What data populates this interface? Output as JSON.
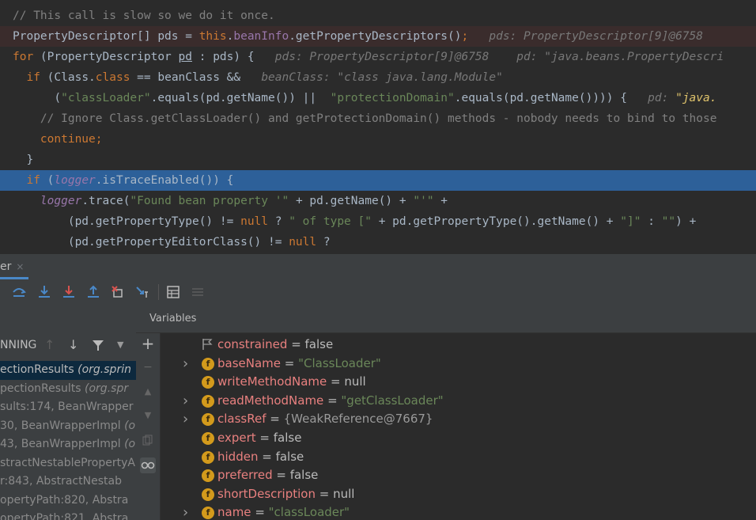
{
  "editor": {
    "lines": [
      [
        [
          "tok-comment",
          "// This call is slow so we do it once."
        ]
      ],
      [
        [
          "tok-plain",
          "PropertyDescriptor[] pds = "
        ],
        [
          "tok-kw",
          "this"
        ],
        [
          "tok-plain",
          "."
        ],
        [
          "tok-field",
          "beanInfo"
        ],
        [
          "tok-plain",
          ".getPropertyDescriptors()"
        ],
        [
          "tok-kw",
          ";"
        ],
        [
          "tok-hint",
          "   pds: PropertyDescriptor[9]@6758"
        ]
      ],
      [
        [
          "tok-kw",
          "for "
        ],
        [
          "tok-plain",
          "(PropertyDescriptor "
        ],
        [
          "tok-ul",
          "pd"
        ],
        [
          "tok-plain",
          " : pds) {"
        ],
        [
          "tok-hint",
          "   pds: PropertyDescriptor[9]@6758    pd: \"java.beans.PropertyDescri"
        ]
      ],
      [
        [
          "tok-plain",
          "  "
        ],
        [
          "tok-kw",
          "if "
        ],
        [
          "tok-plain",
          "(Class."
        ],
        [
          "tok-kw",
          "class"
        ],
        [
          "tok-plain",
          " == beanClass &&"
        ],
        [
          "tok-hint",
          "   beanClass: \"class java.lang.Module\""
        ]
      ],
      [
        [
          "tok-plain",
          "      ("
        ],
        [
          "tok-str",
          "\"classLoader\""
        ],
        [
          "tok-plain",
          ".equals(pd.getName()) ||  "
        ],
        [
          "tok-str",
          "\"protectionDomain\""
        ],
        [
          "tok-plain",
          ".equals(pd.getName()))) {"
        ],
        [
          "tok-hint",
          "   pd: "
        ],
        [
          "tok-hintv",
          "\"java."
        ]
      ],
      [
        [
          "tok-comment",
          "    // Ignore Class.getClassLoader() and getProtectionDomain() methods - nobody needs to bind to those"
        ]
      ],
      [
        [
          "tok-plain",
          "    "
        ],
        [
          "tok-kw",
          "continue;"
        ]
      ],
      [
        [
          "tok-plain",
          "  }"
        ]
      ],
      [
        [
          "tok-plain",
          "  "
        ],
        [
          "tok-kw",
          "if "
        ],
        [
          "tok-plain",
          "("
        ],
        [
          "tok-italicf",
          "logger"
        ],
        [
          "tok-plain",
          ".isTraceEnabled()) {"
        ]
      ],
      [
        [
          "tok-plain",
          "    "
        ],
        [
          "tok-italicf",
          "logger"
        ],
        [
          "tok-plain",
          ".trace("
        ],
        [
          "tok-str",
          "\"Found bean property '\""
        ],
        [
          "tok-plain",
          " + pd.getName() + "
        ],
        [
          "tok-str",
          "\"'\""
        ],
        [
          "tok-plain",
          " +"
        ]
      ],
      [
        [
          "tok-plain",
          "        (pd.getPropertyType() != "
        ],
        [
          "tok-kw",
          "null"
        ],
        [
          "tok-plain",
          " ? "
        ],
        [
          "tok-str",
          "\" of type [\""
        ],
        [
          "tok-plain",
          " + pd.getPropertyType().getName() + "
        ],
        [
          "tok-str",
          "\"]\""
        ],
        [
          "tok-plain",
          " : "
        ],
        [
          "tok-str",
          "\"\""
        ],
        [
          "tok-plain",
          ") +"
        ]
      ],
      [
        [
          "tok-plain",
          "        (pd.getPropertyEditorClass() != "
        ],
        [
          "tok-kw",
          "null"
        ],
        [
          "tok-plain",
          " ?"
        ]
      ]
    ]
  },
  "tab": {
    "label": "er",
    "close": "×"
  },
  "frames_header": {
    "status": "NNING"
  },
  "frames": [
    {
      "name": "ectionResults",
      "loc": " (org.sprin"
    },
    {
      "name": "pectionResults",
      "loc": " (org.spr"
    },
    {
      "name": "sults:174, BeanWrapper",
      "loc": ""
    },
    {
      "name": "30, BeanWrapperImpl",
      "loc": " (o"
    },
    {
      "name": "43, BeanWrapperImpl",
      "loc": " (o"
    },
    {
      "name": "stractNestablePropertyA",
      "loc": ""
    },
    {
      "name": "r:843, AbstractNestab",
      "loc": ""
    },
    {
      "name": "opertyPath:820, Abstra",
      "loc": ""
    },
    {
      "name": "opertyPath:821, Abstra",
      "loc": ""
    }
  ],
  "variables": {
    "header": "Variables",
    "items": [
      {
        "name": "constrained",
        "value": "false",
        "kind": "plain",
        "expandable": false,
        "icon": "flag"
      },
      {
        "name": "baseName",
        "value": "\"ClassLoader\"",
        "kind": "str",
        "expandable": true,
        "icon": "f"
      },
      {
        "name": "writeMethodName",
        "value": "null",
        "kind": "plain",
        "expandable": false,
        "icon": "f"
      },
      {
        "name": "readMethodName",
        "value": "\"getClassLoader\"",
        "kind": "str",
        "expandable": true,
        "icon": "f"
      },
      {
        "name": "classRef",
        "value": "{WeakReference@7667}",
        "kind": "ref",
        "expandable": true,
        "icon": "f"
      },
      {
        "name": "expert",
        "value": "false",
        "kind": "plain",
        "expandable": false,
        "icon": "f"
      },
      {
        "name": "hidden",
        "value": "false",
        "kind": "plain",
        "expandable": false,
        "icon": "f"
      },
      {
        "name": "preferred",
        "value": "false",
        "kind": "plain",
        "expandable": false,
        "icon": "f"
      },
      {
        "name": "shortDescription",
        "value": "null",
        "kind": "plain",
        "expandable": false,
        "icon": "f"
      },
      {
        "name": "name",
        "value": "\"classLoader\"",
        "kind": "str",
        "expandable": true,
        "icon": "f"
      }
    ]
  },
  "colors": {
    "exec_line": "#2d6099",
    "accent": "#4a88c7",
    "field_icon": "#d39a1c"
  }
}
